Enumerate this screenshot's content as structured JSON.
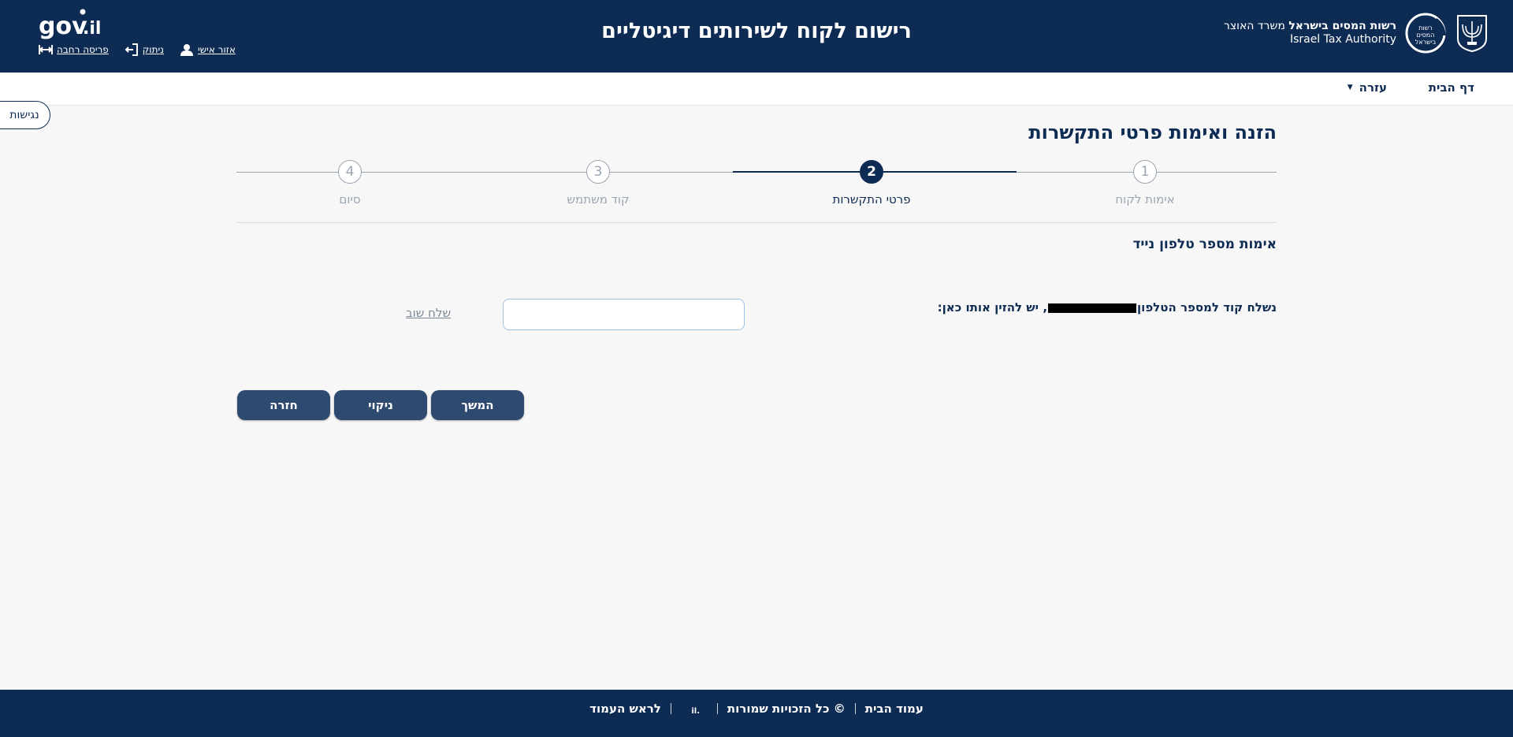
{
  "header": {
    "site_title": "רישום לקוח לשירותים דיגיטליים",
    "brand_line1_bold": "רשות המסים בישראל",
    "brand_line1_rest": " משרד האוצר",
    "brand_line2": "Israel Tax Authority",
    "govil_logo": "gov.il",
    "links": {
      "wide_view": "פריסה רחבה",
      "logout": "ניתוק",
      "personal_area": "אזור אישי"
    }
  },
  "nav": {
    "home": "דף הבית",
    "help": "עזרה"
  },
  "accessibility": "נגישות",
  "page_title": "הזנה ואימות פרטי התקשרות",
  "stepper": {
    "steps": [
      {
        "number": "1",
        "label": "אימות לקוח"
      },
      {
        "number": "2",
        "label": "פרטי התקשרות"
      },
      {
        "number": "3",
        "label": "קוד משתמש"
      },
      {
        "number": "4",
        "label": "סיום"
      }
    ],
    "current": 2
  },
  "section_title": "אימות מספר טלפון נייד",
  "code_form": {
    "sent_label_start": "נשלח קוד למספר הטלפון",
    "sent_label_end": ", יש להזין אותו כאן:",
    "input_value": "",
    "resend": "שלח שוב"
  },
  "buttons": {
    "continue": "המשך",
    "clear": "ניקוי",
    "back": "חזרה"
  },
  "footer": {
    "home_page": "עמוד הבית",
    "copyright": "© כל הזכויות שמורות",
    "back_to_top": "לראש העמוד"
  },
  "colors": {
    "primary": "#0e2c53",
    "button": "#2f4a70",
    "background": "#f7f7f7",
    "inactive_step": "#9aa5b3"
  }
}
